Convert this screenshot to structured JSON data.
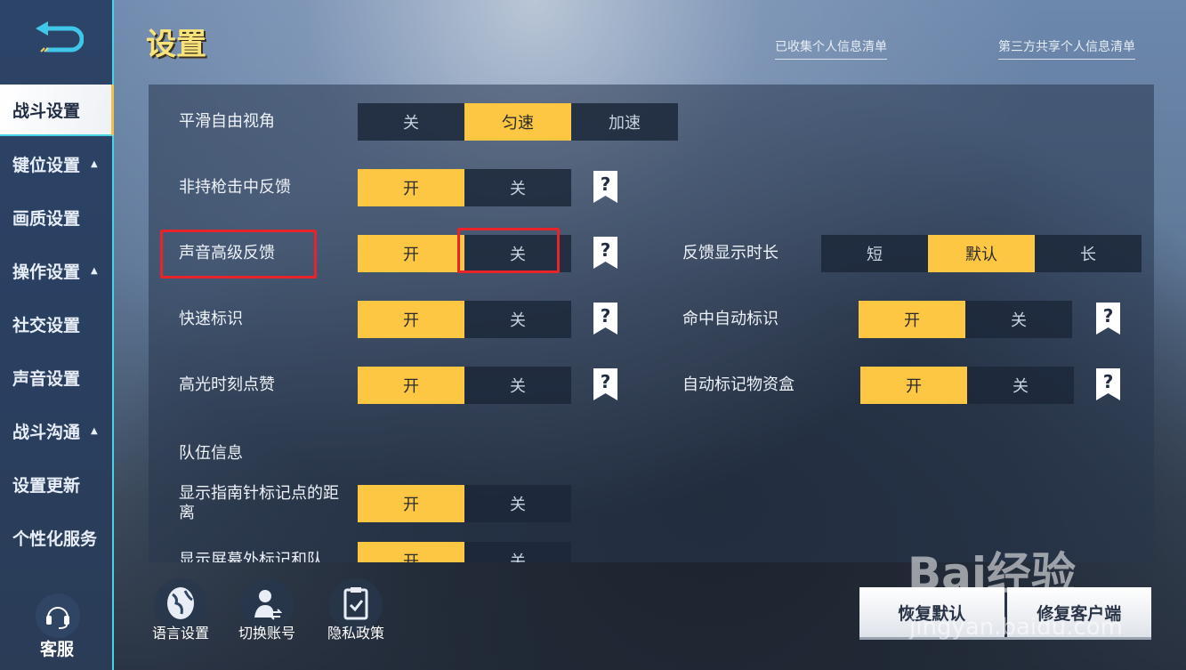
{
  "title": "设置",
  "top_links": [
    "已收集个人信息清单",
    "第三方共享个人信息清单"
  ],
  "sidebar": {
    "items": [
      {
        "label": "战斗设置",
        "active": true,
        "expand": false
      },
      {
        "label": "键位设置",
        "expand": true
      },
      {
        "label": "画质设置",
        "expand": false
      },
      {
        "label": "操作设置",
        "expand": true
      },
      {
        "label": "社交设置",
        "expand": false
      },
      {
        "label": "声音设置",
        "expand": false
      },
      {
        "label": "战斗沟通",
        "expand": true
      },
      {
        "label": "设置更新",
        "expand": false
      },
      {
        "label": "个性化服务",
        "expand": false
      }
    ],
    "expand_glyph": "▲",
    "customer_service": "客服"
  },
  "settings_left": [
    {
      "label": "平滑自由视角",
      "options": [
        "关",
        "匀速",
        "加速"
      ],
      "selected": 1,
      "help": false
    },
    {
      "label": "非持枪击中反馈",
      "options": [
        "开",
        "关"
      ],
      "selected": 0,
      "help": true
    },
    {
      "label": "声音高级反馈",
      "options": [
        "开",
        "关"
      ],
      "selected": 0,
      "help": true
    },
    {
      "label": "快速标识",
      "options": [
        "开",
        "关"
      ],
      "selected": 0,
      "help": true
    },
    {
      "label": "高光时刻点赞",
      "options": [
        "开",
        "关"
      ],
      "selected": 0,
      "help": true
    },
    {
      "label": "队伍信息"
    },
    {
      "label": "显示指南针标记点的距离",
      "options": [
        "开",
        "关"
      ],
      "selected": 0,
      "help": false
    },
    {
      "label": "显示屏幕外标记和队",
      "options": [
        "开",
        "关"
      ],
      "selected": 0,
      "help": false
    }
  ],
  "settings_right": [
    {
      "label": "反馈显示时长",
      "options": [
        "短",
        "默认",
        "长"
      ],
      "selected": 1,
      "help": false
    },
    {
      "label": "命中自动标识",
      "options": [
        "开",
        "关"
      ],
      "selected": 0,
      "help": true
    },
    {
      "label": "自动标记物资盒",
      "options": [
        "开",
        "关"
      ],
      "selected": 0,
      "help": true
    }
  ],
  "bottom_icons": [
    {
      "label": "语言设置",
      "icon": "globe-icon"
    },
    {
      "label": "切换账号",
      "icon": "switch-account-icon"
    },
    {
      "label": "隐私政策",
      "icon": "clipboard-check-icon"
    }
  ],
  "buttons": {
    "restore": "恢复默认",
    "repair": "修复客户端"
  },
  "watermark": {
    "brand": "Bai经验",
    "url": "jingyan.baidu.com"
  },
  "colors": {
    "accent": "#fdc643",
    "highlight": "#e8232a",
    "border": "#47d4e6"
  }
}
